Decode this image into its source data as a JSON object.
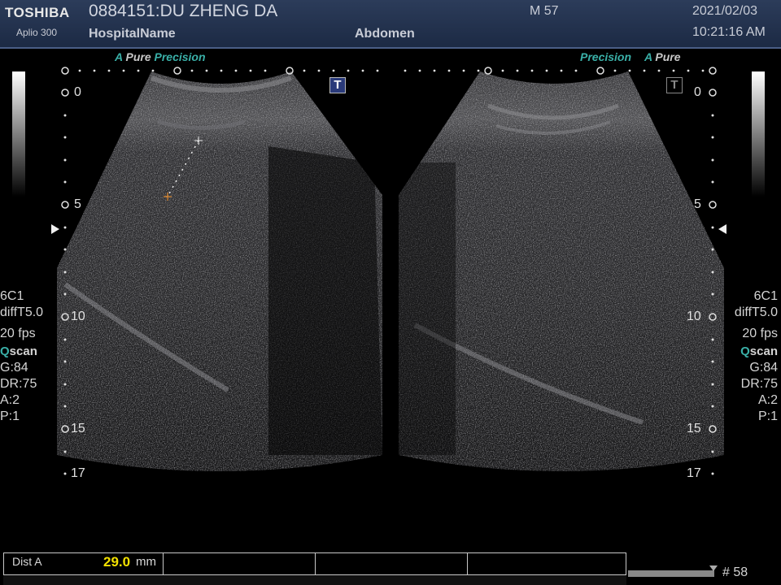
{
  "header": {
    "logo": "TOSHIBA",
    "model": "Aplio 300",
    "patient": "0884151:DU ZHENG DA",
    "hospital": "HospitalName",
    "sex_age": "M 57",
    "exam": "Abdomen",
    "date": "2021/02/03",
    "time": "10:21:16 AM"
  },
  "left_panel": {
    "mode_a": "A",
    "mode_pure": "Pure",
    "mode_p": "P",
    "mode_recision": "recision",
    "depth_labels": [
      "0",
      "5",
      "10",
      "15",
      "17"
    ],
    "tbutton": "T",
    "info": {
      "probe": "6C1",
      "mode": "diffT5.0",
      "fps": "20 fps",
      "qscan_q": "Q",
      "qscan_rest": "scan",
      "gain": "G:84",
      "dr": "DR:75",
      "a": "A:2",
      "p": "P:1"
    }
  },
  "right_panel": {
    "mode_p": "P",
    "mode_recision": "recision",
    "mode_a": "A",
    "mode_pure": "Pure",
    "depth_labels": [
      "0",
      "5",
      "10",
      "15",
      "17"
    ],
    "tbutton": "T",
    "info": {
      "probe": "6C1",
      "mode": "diffT5.0",
      "fps": "20 fps",
      "qscan_q": "Q",
      "qscan_rest": "scan",
      "gain": "G:84",
      "dr": "DR:75",
      "a": "A:2",
      "p": "P:1"
    }
  },
  "measurement": {
    "label": "Dist A",
    "value": "29.0",
    "unit": "mm"
  },
  "cine": {
    "frame": "# 58"
  },
  "colors": {
    "accent_teal": "#3ab0a8",
    "measure_yellow": "#f2e000",
    "header_bg": "#24324e",
    "active_tbutton": "#2a3a7a"
  }
}
